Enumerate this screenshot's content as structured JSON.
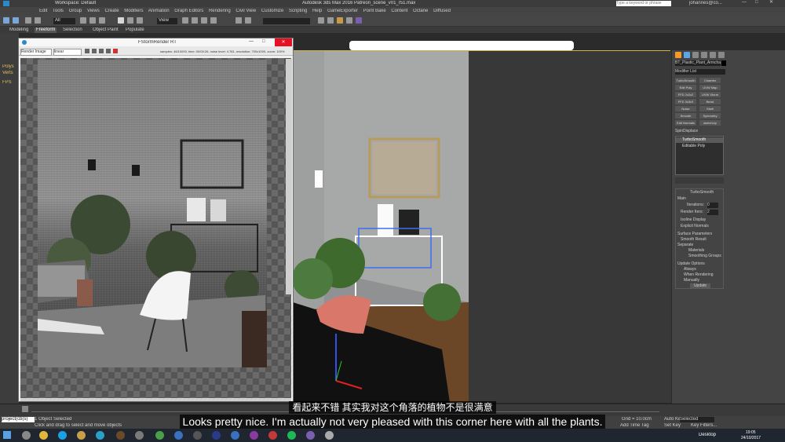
{
  "window": {
    "title": "Autodesk 3ds Max 2016    Patreon_scene_v01_r51.max",
    "workspace": "Workspace: Default",
    "search_placeholder": "Type a keyword or phrase",
    "user": "johannes@co..."
  },
  "menu": {
    "items": [
      "Edit",
      "Tools",
      "Group",
      "Views",
      "Create",
      "Modifiers",
      "Animation",
      "Graph Editors",
      "Rendering",
      "Civil View",
      "Customize",
      "Scripting",
      "Help",
      "GameExporter",
      "Point Bake",
      "Content",
      "Octane",
      "Diffused"
    ]
  },
  "toolbar": {
    "selection_filter": "All",
    "view_dropdown": "View"
  },
  "ribbon": {
    "tabs": [
      "Modeling",
      "Freeform",
      "Selection",
      "Object Paint",
      "Populate"
    ]
  },
  "left_labels": [
    "Polys",
    "Verts",
    "FPS"
  ],
  "render_frame": {
    "title": "FStormRender RT",
    "channel": "Render Image",
    "lut": "linear",
    "stats": "samples: 46/10000, time: 00/00:26, noise level: 4.781, resolution: 700x1000, zoom: 100%",
    "denoise_label": "Sg. Preview"
  },
  "command_panel": {
    "object_name": "BT_Plastic_Plant_Armchair_D",
    "modifier_list": "Modifier List",
    "buttons": [
      [
        "TurboSmooth",
        "Chamfer"
      ],
      [
        "Edit Poly",
        "UVW Map"
      ],
      [
        "FFD 2x2x2",
        "UVW Xform"
      ],
      [
        "FFD 3x3x3",
        "Bend"
      ],
      [
        "Noise",
        "Shell"
      ],
      [
        "Smooth",
        "Symmetry"
      ],
      [
        "Edit Normals",
        "sketchUp Osma"
      ]
    ],
    "extra_label": "SpinDisplace",
    "stack": [
      "TurboSmooth",
      "Editable Poly"
    ],
    "rollout_title": "TurboSmooth",
    "main_label": "Main",
    "iterations_label": "Iterations:",
    "iterations_value": "0",
    "render_iters_label": "Render Iters:",
    "render_iters_value": "2",
    "isoline": "Isoline Display",
    "explicit": "Explicit Normals",
    "surface_params": "Surface Parameters",
    "smooth_result": "Smooth Result",
    "separate": "Separate",
    "materials": "Materials",
    "smoothing_groups": "Smoothing Groups",
    "update_options": "Update Options",
    "always": "Always",
    "when_rendering": "When Rendering",
    "manually": "Manually",
    "update_btn": "Update"
  },
  "status": {
    "selected": "1 Object Selected",
    "hint": "Click and drag to select and move objects",
    "grid": "Grid = 10.0cm",
    "auto_key": "Auto Key",
    "set_key": "Set Key",
    "selected_dd": "Selected",
    "key_filters": "Key Filters...",
    "add_time_tag": "Add Time Tag",
    "maxscript": "project(cb(s)"
  },
  "taskbar": {
    "desktop": "Desktop",
    "time": "19:05",
    "date": "24/10/2017"
  },
  "subtitles": {
    "zh": "看起来不错 其实我对这个角落的植物不是很满意",
    "en": "Looks pretty nice. I'm actually not very pleased with this corner here with all the plants."
  }
}
